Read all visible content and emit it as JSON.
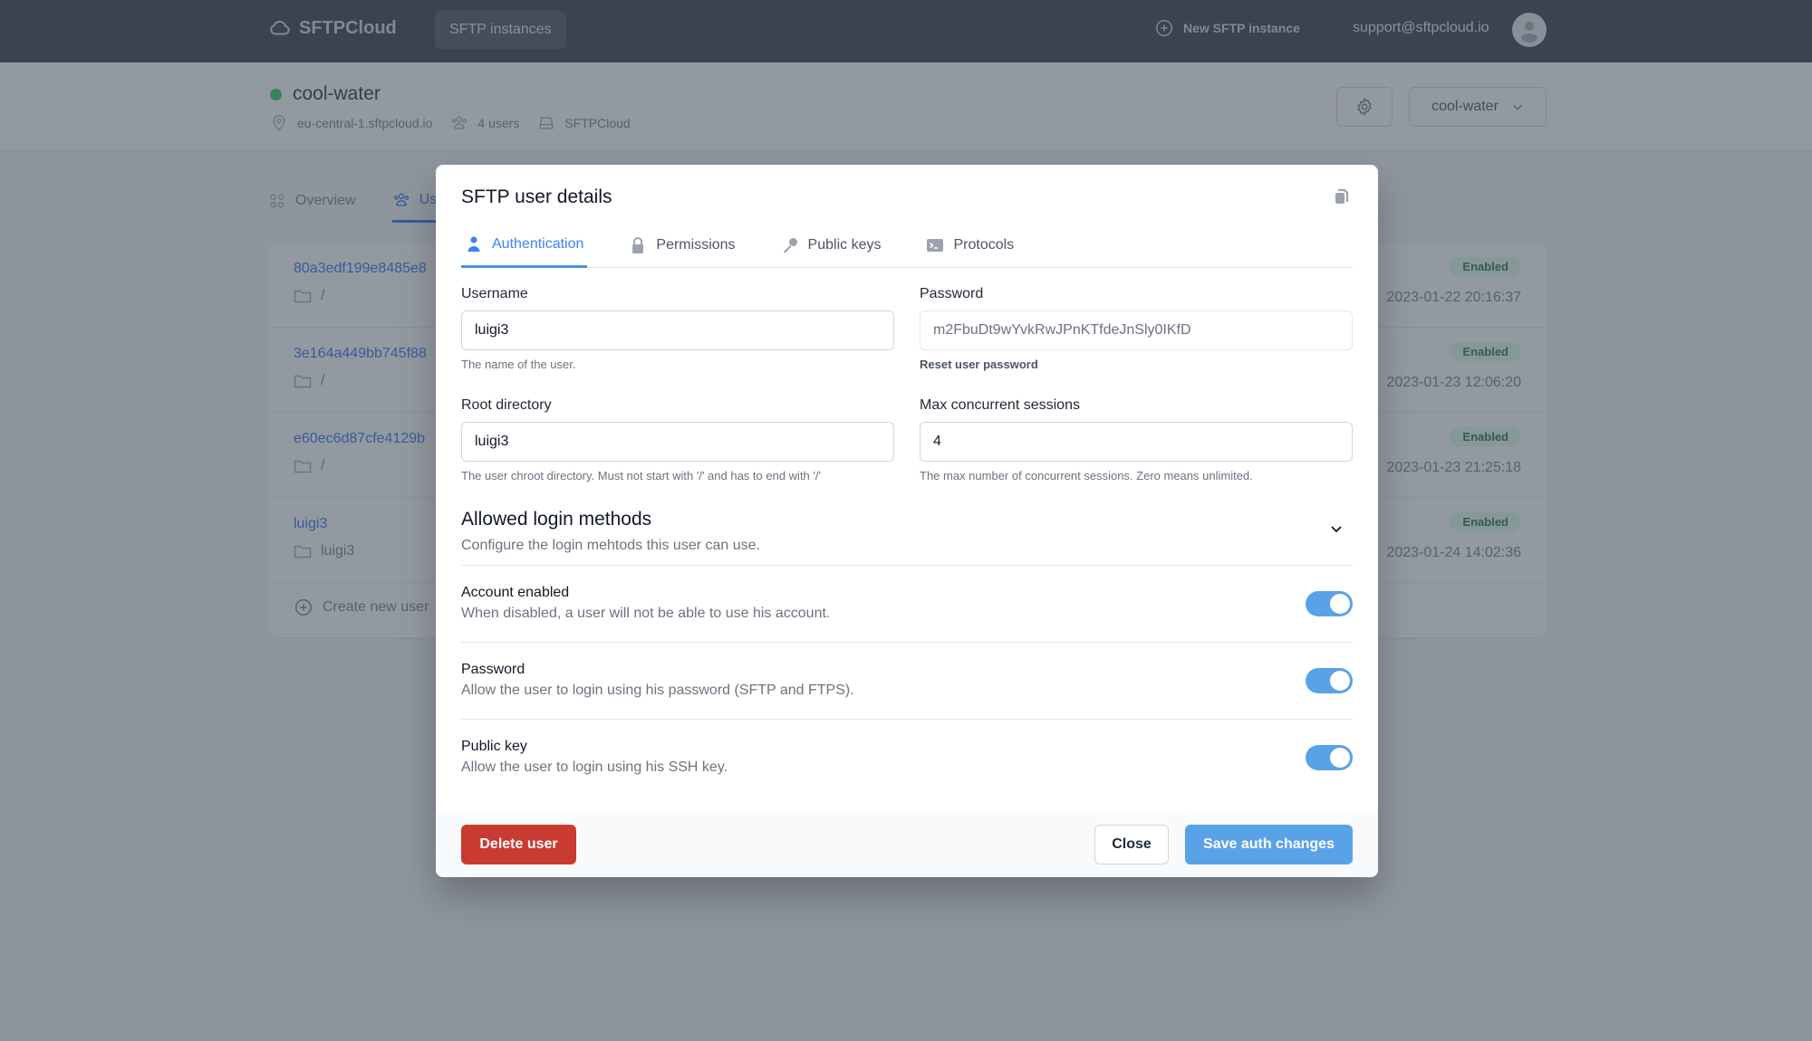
{
  "topnav": {
    "brand": "SFTPCloud",
    "nav_item": "SFTP instances",
    "new_instance": "New SFTP instance",
    "user_email": "support@sftpcloud.io"
  },
  "instance": {
    "name": "cool-water",
    "status_color": "#22c55e",
    "host": "eu-central-1.sftpcloud.io",
    "users": "4 users",
    "storage": "SFTPCloud",
    "selector_value": "cool-water"
  },
  "page_tabs": [
    {
      "label": "Overview",
      "icon": "grid-icon",
      "active": false
    },
    {
      "label": "Users",
      "icon": "users-icon",
      "active": true
    }
  ],
  "user_list": {
    "rows": [
      {
        "name": "80a3edf199e8485e8",
        "dir": "/",
        "status": "Enabled",
        "created": "2023-01-22 20:16:37"
      },
      {
        "name": "3e164a449bb745f88",
        "dir": "/",
        "status": "Enabled",
        "created": "2023-01-23 12:06:20"
      },
      {
        "name": "e60ec6d87cfe4129b",
        "dir": "/",
        "status": "Enabled",
        "created": "2023-01-23 21:25:18"
      },
      {
        "name": "luigi3",
        "dir": "luigi3",
        "status": "Enabled",
        "created": "2023-01-24 14:02:36"
      }
    ],
    "create_label": "Create new user"
  },
  "modal": {
    "title": "SFTP user details",
    "tabs": [
      {
        "label": "Authentication",
        "icon": "user-icon",
        "active": true
      },
      {
        "label": "Permissions",
        "icon": "lock-icon",
        "active": false
      },
      {
        "label": "Public keys",
        "icon": "key-icon",
        "active": false
      },
      {
        "label": "Protocols",
        "icon": "terminal-icon",
        "active": false
      }
    ],
    "fields": {
      "username": {
        "label": "Username",
        "value": "luigi3",
        "hint": "The name of the user."
      },
      "password": {
        "label": "Password",
        "value": "m2FbuDt9wYvkRwJPnKTfdeJnSly0IKfD",
        "hint": "Reset user password"
      },
      "root_dir": {
        "label": "Root directory",
        "value": "luigi3",
        "hint": "The user chroot directory. Must not start with '/' and has to end with '/'"
      },
      "max_sessions": {
        "label": "Max concurrent sessions",
        "value": "4",
        "hint": "The max number of concurrent sessions. Zero means unlimited."
      }
    },
    "login_methods": {
      "title": "Allowed login methods",
      "subtitle": "Configure the login mehtods this user can use.",
      "toggles": [
        {
          "title": "Account enabled",
          "desc": "When disabled, a user will not be able to use his account.",
          "on": true
        },
        {
          "title": "Password",
          "desc": "Allow the user to login using his password (SFTP and FTPS).",
          "on": true
        },
        {
          "title": "Public key",
          "desc": "Allow the user to login using his SSH key.",
          "on": true
        }
      ]
    },
    "footer": {
      "delete": "Delete user",
      "close": "Close",
      "save": "Save auth changes"
    }
  },
  "colors": {
    "primary": "#5aa2e8",
    "danger": "#c93a32",
    "active_tab": "#3b82f6"
  }
}
